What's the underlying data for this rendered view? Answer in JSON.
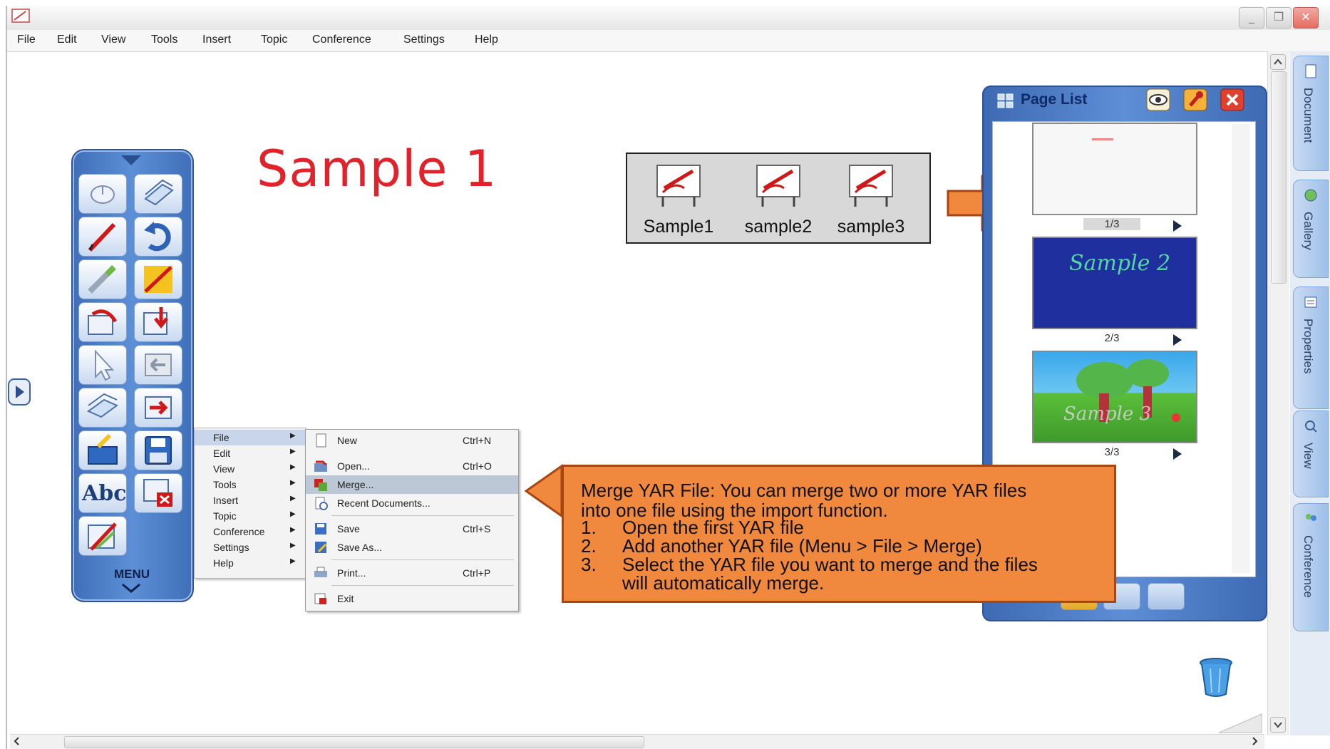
{
  "menubar": {
    "items": [
      "File",
      "Edit",
      "View",
      "Tools",
      "Insert",
      "Topic",
      "Conference",
      "Settings",
      "Help"
    ]
  },
  "canvas": {
    "title": "Sample 1"
  },
  "files": [
    {
      "name": "Sample1"
    },
    {
      "name": "sample2"
    },
    {
      "name": "sample3"
    }
  ],
  "page_list": {
    "title": "Page List",
    "pages": [
      {
        "label": "1/3"
      },
      {
        "label": "2/3",
        "thumb_text": "Sample 2"
      },
      {
        "label": "3/3",
        "thumb_text": "Sample 3"
      }
    ]
  },
  "toolbar": {
    "menu_label": "MENU",
    "text_tool_label": "Abc"
  },
  "main_menu": {
    "items": [
      "File",
      "Edit",
      "View",
      "Tools",
      "Insert",
      "Topic",
      "Conference",
      "Settings",
      "Help"
    ]
  },
  "file_submenu": {
    "items": [
      {
        "label": "New",
        "shortcut": "Ctrl+N"
      },
      {
        "label": "Open...",
        "shortcut": "Ctrl+O"
      },
      {
        "label": "Merge...",
        "shortcut": ""
      },
      {
        "label": "Recent Documents...",
        "shortcut": ""
      },
      {
        "label": "Save",
        "shortcut": "Ctrl+S"
      },
      {
        "label": "Save As...",
        "shortcut": ""
      },
      {
        "label": "Print...",
        "shortcut": "Ctrl+P"
      },
      {
        "label": "Exit",
        "shortcut": ""
      }
    ]
  },
  "callout": {
    "line1": "Merge YAR File: You can merge two or more YAR files",
    "line2": "into one file using the import function.",
    "steps": [
      {
        "num": "1.",
        "text": "Open the first YAR file"
      },
      {
        "num": "2.",
        "text": "Add another YAR file (Menu > File > Merge)"
      },
      {
        "num": "3.",
        "text": "Select the YAR file you want to merge and the files"
      }
    ],
    "line_cont": "will automatically merge."
  },
  "side_tabs": [
    "Document",
    "Gallery",
    "Properties",
    "View",
    "Conference"
  ],
  "colors": {
    "accent_orange": "#f0883e",
    "toolbar_blue": "#4a7cc6",
    "title_red": "#e1222b",
    "page2_bg": "#1f2f9e"
  },
  "icons": {
    "app": "yar-logo-icon",
    "trash": "trash-icon",
    "expander": "play-icon"
  }
}
